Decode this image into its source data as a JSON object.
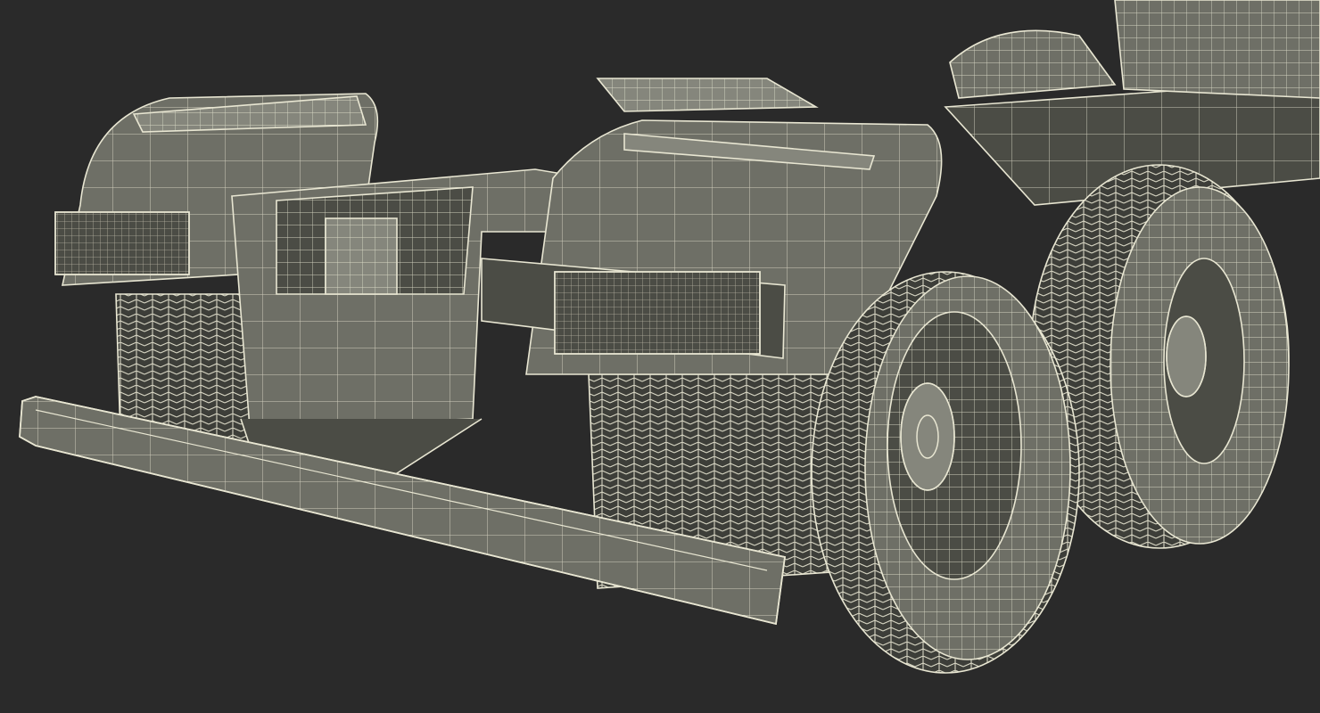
{
  "scene": {
    "subject": "wireframe-truck-chassis-rear",
    "colors": {
      "background": "#2a2a2a",
      "surface": "#6e6f66",
      "surface_light": "#85867c",
      "surface_dark": "#4b4c45",
      "tire": "#3d3e39",
      "wire": "#e8e6d2"
    }
  }
}
